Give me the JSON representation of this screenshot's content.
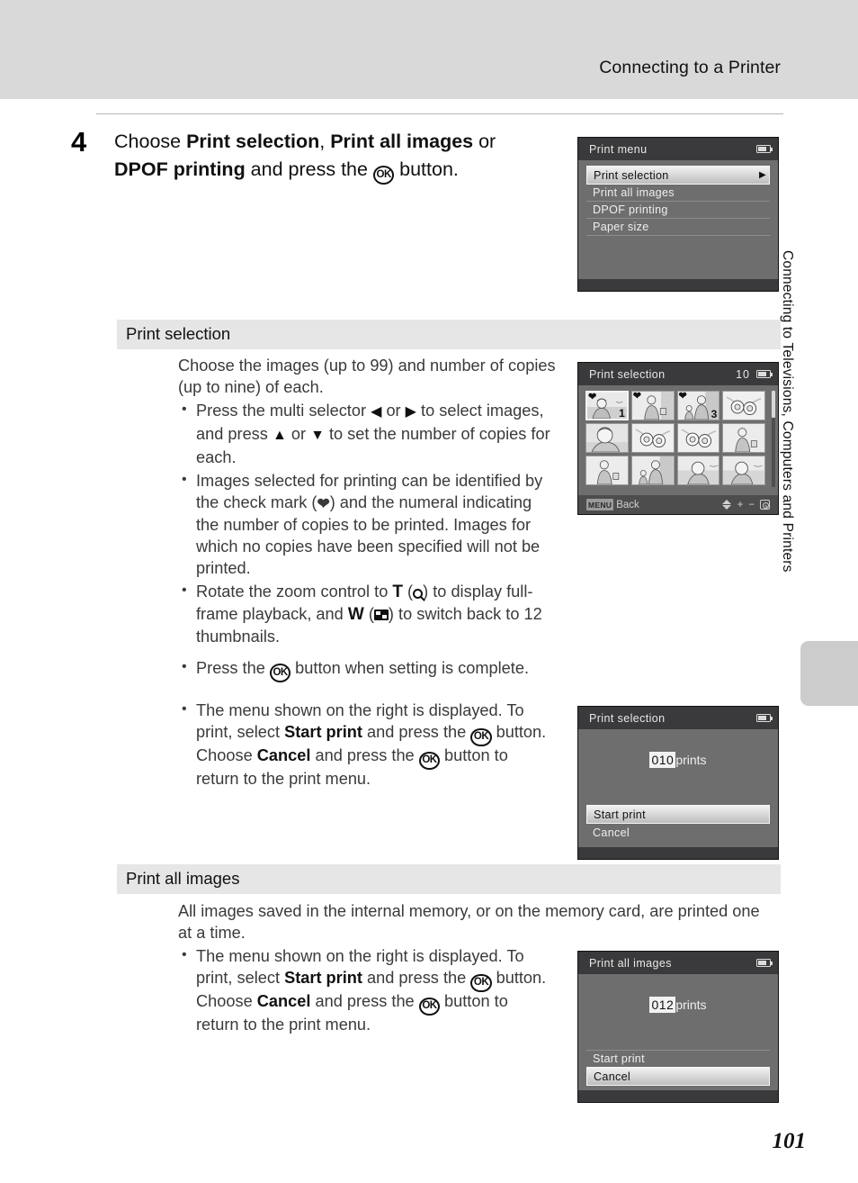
{
  "header": {
    "title": "Connecting to a Printer"
  },
  "side_tab": {
    "label": "Connecting to Televisions, Computers and Printers"
  },
  "page_number": "101",
  "step": {
    "number": "4",
    "line1_a": "Choose ",
    "line1_b": "Print selection",
    "line1_c": ", ",
    "line1_d": "Print all images",
    "line1_e": " or ",
    "line2_a": "DPOF printing",
    "line2_b": " and press the ",
    "ok_glyph": "OK",
    "line2_c": " button."
  },
  "sections": [
    {
      "title": "Print selection",
      "intro": "Choose the images (up to 99) and number of copies (up to nine) of each.",
      "bullets": [
        {
          "p1": "Press the multi selector ",
          "left": "◀",
          "p2": " or ",
          "right": "▶",
          "p3": " to select images, and press ",
          "up": "▲",
          "p4": " or ",
          "down": "▼",
          "p5": " to set the number of copies for each."
        },
        {
          "p1": "Images selected for printing can be identified by the check mark (",
          "check": "❤",
          "p2": ") and the numeral indicating the number of copies to be printed. Images for which no copies have been specified will not be printed."
        },
        {
          "p1": "Rotate the zoom control to ",
          "t": "T",
          "p2": " (",
          "p3": ") to display full-frame playback, and ",
          "w": "W",
          "p4": " (",
          "p5": ") to switch back to 12 thumbnails."
        },
        {
          "p1": "Press the ",
          "ok": "OK",
          "p2": " button when setting is complete."
        },
        {
          "p1": "The menu shown on the right is displayed. To print, select ",
          "b1": "Start print",
          "p2": " and press the ",
          "ok1": "OK",
          "p3": " button. Choose ",
          "b2": "Cancel",
          "p4": " and press the ",
          "ok2": "OK",
          "p5": " button to return to the print menu."
        }
      ]
    },
    {
      "title": "Print all images",
      "intro": "All images saved in the internal memory, or on the memory card, are printed one at a time.",
      "bullets": [
        {
          "p1": "The menu shown on the right is displayed. To print, select ",
          "b1": "Start print",
          "p2": " and press the ",
          "ok1": "OK",
          "p3": " button. Choose ",
          "b2": "Cancel",
          "p4": " and press the ",
          "ok2": "OK",
          "p5": " button to return to the print menu."
        }
      ]
    }
  ],
  "screens": {
    "print_menu": {
      "title": "Print menu",
      "items": [
        {
          "label": "Print selection",
          "selected": true,
          "arrow": "▶"
        },
        {
          "label": "Print all images",
          "selected": false
        },
        {
          "label": "DPOF printing",
          "selected": false
        },
        {
          "label": "Paper size",
          "selected": false
        }
      ]
    },
    "print_selection_grid": {
      "title": "Print selection",
      "count": "10",
      "thumbnails": [
        {
          "scene": "woman-beach",
          "check": "❤",
          "copies": "1",
          "active": true
        },
        {
          "scene": "woman-bag",
          "check": "❤",
          "copies": ""
        },
        {
          "scene": "family",
          "check": "❤",
          "copies": "3"
        },
        {
          "scene": "flowers",
          "check": "",
          "copies": ""
        },
        {
          "scene": "portrait",
          "check": "",
          "copies": ""
        },
        {
          "scene": "flowers",
          "check": "",
          "copies": ""
        },
        {
          "scene": "flowers",
          "check": "",
          "copies": ""
        },
        {
          "scene": "woman-bag",
          "check": "",
          "copies": ""
        },
        {
          "scene": "woman-bag",
          "check": "",
          "copies": ""
        },
        {
          "scene": "family",
          "check": "",
          "copies": ""
        },
        {
          "scene": "woman-beach",
          "check": "",
          "copies": ""
        },
        {
          "scene": "woman-beach",
          "check": "",
          "copies": ""
        }
      ],
      "toolbar": {
        "menu_badge": "MENU",
        "back_label": "Back"
      }
    },
    "print_selection_confirm": {
      "title": "Print selection",
      "prints_number": "010",
      "prints_label": "prints",
      "rows": [
        {
          "label": "Start print",
          "selected": true
        },
        {
          "label": "Cancel",
          "selected": false
        }
      ]
    },
    "print_all_confirm": {
      "title": "Print all images",
      "prints_number": "012",
      "prints_label": "prints",
      "rows": [
        {
          "label": "Start print",
          "selected": false
        },
        {
          "label": "Cancel",
          "selected": true
        }
      ]
    }
  },
  "colors": {
    "header_band": "#d9d9d9",
    "section_band": "#e6e6e6",
    "lcd_bg": "#6e6e6e",
    "lcd_titlebar": "#3a3a3c",
    "side_tab": "#cccccc"
  }
}
